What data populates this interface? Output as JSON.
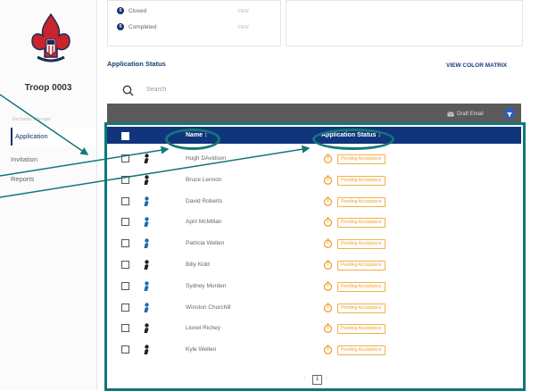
{
  "sidebar": {
    "troop_name": "Troop 0003",
    "sub_label": "Recharter Manager",
    "items": [
      {
        "label": "Application"
      },
      {
        "label": "Invitation"
      },
      {
        "label": "Reports"
      }
    ]
  },
  "status_summary": {
    "items": [
      {
        "count": "0",
        "label": "Closed",
        "action": "VIEW"
      },
      {
        "count": "0",
        "label": "Completed",
        "action": "VIEW"
      }
    ]
  },
  "app_status": {
    "title": "Application Status",
    "matrix_link": "VIEW COLOR MATRIX",
    "search_placeholder": "Search",
    "draft_email": "Draft Email"
  },
  "table": {
    "columns": {
      "name": "Name ↕",
      "status": "Application Status ↓"
    },
    "rows": [
      {
        "name": "Hugh DAvidson",
        "status": "Pending Acceptance"
      },
      {
        "name": "Bruce Lennon",
        "status": "Pending Acceptance"
      },
      {
        "name": "David Roberts",
        "status": "Pending Acceptance"
      },
      {
        "name": "April McMillan",
        "status": "Pending Acceptance"
      },
      {
        "name": "Patricia Wellen",
        "status": "Pending Acceptance"
      },
      {
        "name": "Billy Kidd",
        "status": "Pending Acceptance"
      },
      {
        "name": "Sydney Murden",
        "status": "Pending Acceptance"
      },
      {
        "name": "Winston Churchill",
        "status": "Pending Acceptance"
      },
      {
        "name": "Lionel Richey",
        "status": "Pending Acceptance"
      },
      {
        "name": "Kyle Wellen",
        "status": "Pending Acceptance"
      }
    ],
    "page": "1"
  },
  "colors": {
    "navy": "#11357c",
    "teal": "#117778",
    "pending": "#f0a030",
    "person_blue": "#1f6aa8"
  },
  "icons": [
    "bsa-logo-icon",
    "search-icon",
    "email-icon",
    "filter-icon",
    "person-icon",
    "stopwatch-icon"
  ]
}
